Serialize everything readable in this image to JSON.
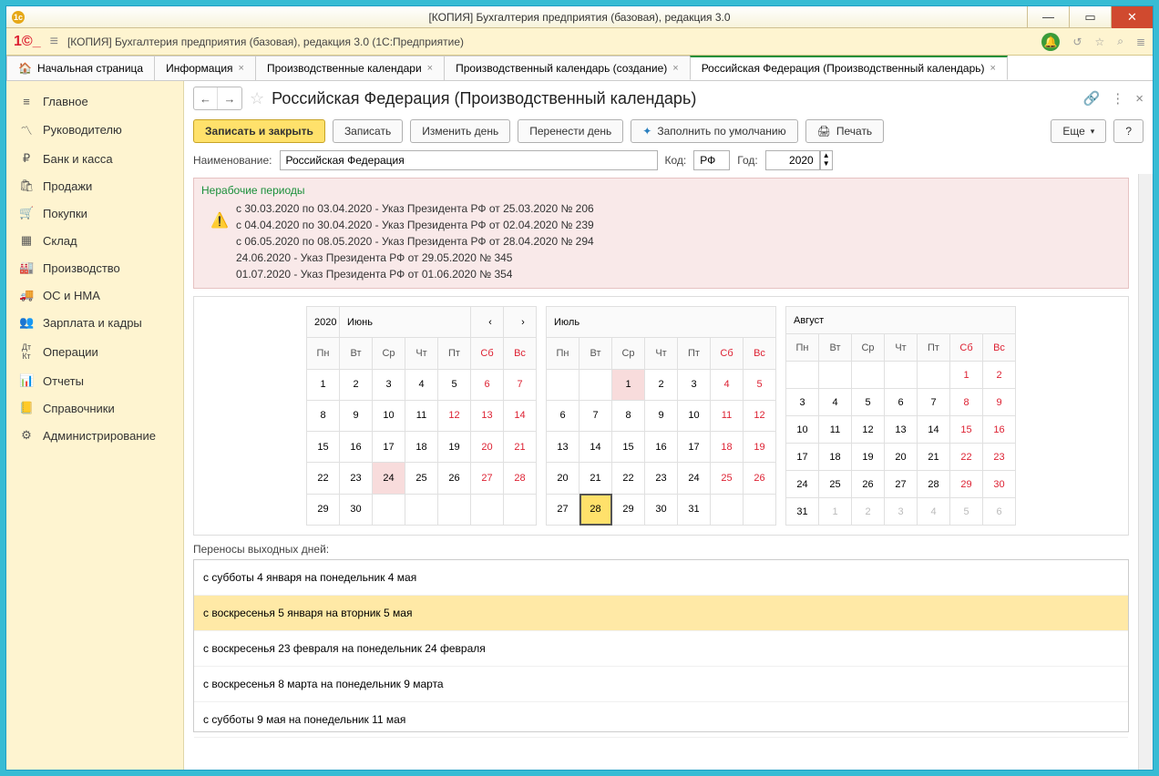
{
  "window": {
    "title": "[КОПИЯ] Бухгалтерия предприятия (базовая), редакция 3.0",
    "subtitle": "[КОПИЯ] Бухгалтерия предприятия (базовая), редакция 3.0  (1С:Предприятие)"
  },
  "tabs": {
    "home": "Начальная страница",
    "t1": "Информация",
    "t2": "Производственные календари",
    "t3": "Производственный календарь (создание)",
    "t4": "Российская Федерация (Производственный календарь)"
  },
  "sidebar": {
    "main": "Главное",
    "manager": "Руководителю",
    "bank": "Банк и касса",
    "sales": "Продажи",
    "purchases": "Покупки",
    "warehouse": "Склад",
    "production": "Производство",
    "fixed": "ОС и НМА",
    "salary": "Зарплата и кадры",
    "operations": "Операции",
    "reports": "Отчеты",
    "directories": "Справочники",
    "admin": "Администрирование"
  },
  "page": {
    "title": "Российская Федерация (Производственный календарь)"
  },
  "toolbar": {
    "save_close": "Записать и закрыть",
    "save": "Записать",
    "change_day": "Изменить день",
    "move_day": "Перенести день",
    "fill_default": "Заполнить по умолчанию",
    "print": "Печать",
    "more": "Еще",
    "help": "?"
  },
  "form": {
    "name_label": "Наименование:",
    "name_value": "Российская Федерация",
    "code_label": "Код:",
    "code_value": "РФ",
    "year_label": "Год:",
    "year_value": "2020"
  },
  "non_working": {
    "header": "Нерабочие периоды",
    "lines": {
      "l1": "с 30.03.2020 по 03.04.2020 - Указ Президента РФ от 25.03.2020 № 206",
      "l2": "с 04.04.2020 по 30.04.2020 - Указ Президента РФ от 02.04.2020 № 239",
      "l3": "с 06.05.2020 по 08.05.2020 - Указ Президента РФ от 28.04.2020 № 294",
      "l4": "24.06.2020 - Указ Президента РФ от 29.05.2020 № 345",
      "l5": "01.07.2020 - Указ Президента РФ от 01.06.2020 № 354"
    }
  },
  "calendar": {
    "year": "2020",
    "months": {
      "m6": "Июнь",
      "m7": "Июль",
      "m8": "Август"
    },
    "weekdays": {
      "mon": "Пн",
      "tue": "Вт",
      "wed": "Ср",
      "thu": "Чт",
      "fri": "Пт",
      "sat": "Сб",
      "sun": "Вс"
    }
  },
  "transfers": {
    "label": "Переносы выходных дней:",
    "r1": "с субботы 4 января на понедельник 4 мая",
    "r2": "с воскресенья 5 января на вторник 5 мая",
    "r3": "с воскресенья 23 февраля на понедельник 24 февраля",
    "r4": "с воскресенья 8 марта на понедельник 9 марта",
    "r5": "с субботы 9 мая на понедельник 11 мая"
  }
}
